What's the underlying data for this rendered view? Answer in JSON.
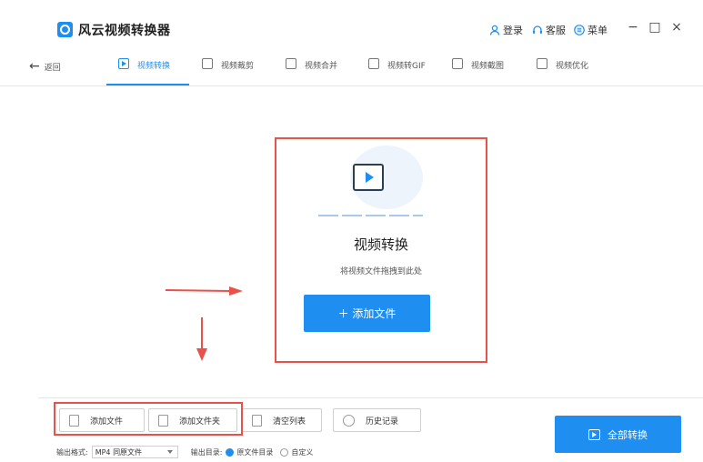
{
  "app": {
    "title": "风云视频转换器"
  },
  "titlebar": {
    "login": "登录",
    "service": "客服",
    "menu": "菜单",
    "minimize": "−",
    "maximize": "□",
    "close": "×"
  },
  "toolbar": {
    "back": "返回",
    "tabs": [
      {
        "label": "视频转换",
        "active": true
      },
      {
        "label": "视频裁剪"
      },
      {
        "label": "视频合并"
      },
      {
        "label": "视频转GIF"
      },
      {
        "label": "视频截图"
      },
      {
        "label": "视频优化"
      }
    ]
  },
  "dropzone": {
    "title": "视频转换",
    "subtitle": "将视频文件拖拽到此处",
    "add_button": "＋ 添加文件"
  },
  "bottom": {
    "add_file": "添加文件",
    "add_folder": "添加文件夹",
    "clear_list": "清空列表",
    "history": "历史记录",
    "convert_all": "全部转换",
    "format_label": "输出格式:",
    "format_value": "MP4 同原文件",
    "dir_label": "输出目录:",
    "dir_source": "原文件目录",
    "dir_custom": "自定义"
  },
  "colors": {
    "accent": "#1e8ef0",
    "highlight": "#e8524b"
  }
}
